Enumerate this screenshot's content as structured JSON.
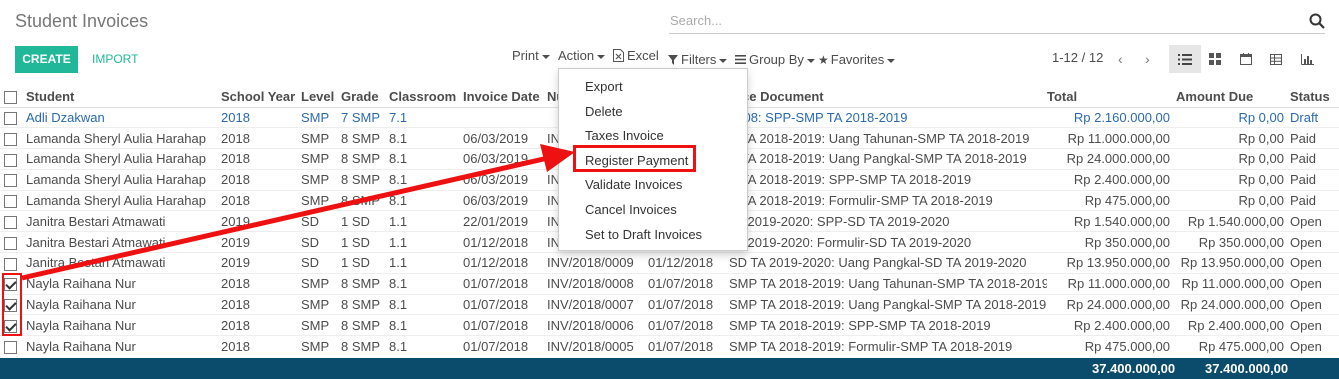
{
  "header": {
    "title": "Student Invoices"
  },
  "search": {
    "placeholder": "Search..."
  },
  "buttons": {
    "create": "CREATE",
    "import": "IMPORT"
  },
  "toolbar": {
    "print": "Print",
    "action": "Action",
    "excel": "Excel",
    "filters": "Filters",
    "group_by": "Group By",
    "favorites": "Favorites"
  },
  "pager": {
    "range": "1-12 / 12"
  },
  "columns": [
    "Student",
    "School Year",
    "Level",
    "Grade",
    "Classroom",
    "Invoice Date",
    "Nu",
    "",
    "urce Document",
    "Total",
    "Amount Due",
    "Status"
  ],
  "rows": [
    {
      "student": "Adli Dzakwan",
      "year": "2018",
      "level": "SMP",
      "grade": "7 SMP",
      "class": "7.1",
      "date": "",
      "number": "",
      "due_date": "",
      "source": "2108: SPP-SMP TA 2018-2019",
      "total": "Rp 2.160.000,00",
      "amount_due": "Rp 0,00",
      "status": "Draft",
      "checked": false
    },
    {
      "student": "Lamanda Sheryl Aulia Harahap",
      "year": "2018",
      "level": "SMP",
      "grade": "8 SMP",
      "class": "8.1",
      "date": "06/03/2019",
      "number": "IN",
      "due_date": "",
      "source": "P TA 2018-2019: Uang Tahunan-SMP TA 2018-2019",
      "total": "Rp 11.000.000,00",
      "amount_due": "Rp 0,00",
      "status": "Paid",
      "checked": false
    },
    {
      "student": "Lamanda Sheryl Aulia Harahap",
      "year": "2018",
      "level": "SMP",
      "grade": "8 SMP",
      "class": "8.1",
      "date": "06/03/2019",
      "number": "IN",
      "due_date": "",
      "source": "P TA 2018-2019: Uang Pangkal-SMP TA 2018-2019",
      "total": "Rp 24.000.000,00",
      "amount_due": "Rp 0,00",
      "status": "Paid",
      "checked": false
    },
    {
      "student": "Lamanda Sheryl Aulia Harahap",
      "year": "2018",
      "level": "SMP",
      "grade": "8 SMP",
      "class": "8.1",
      "date": "06/03/2019",
      "number": "IN",
      "due_date": "",
      "source": "P TA 2018-2019: SPP-SMP TA 2018-2019",
      "total": "Rp 2.400.000,00",
      "amount_due": "Rp 0,00",
      "status": "Paid",
      "checked": false
    },
    {
      "student": "Lamanda Sheryl Aulia Harahap",
      "year": "2018",
      "level": "SMP",
      "grade": "8 SMP",
      "class": "8.1",
      "date": "06/03/2019",
      "number": "IN",
      "due_date": "",
      "source": "P TA 2018-2019: Formulir-SMP TA 2018-2019",
      "total": "Rp 475.000,00",
      "amount_due": "Rp 0,00",
      "status": "Paid",
      "checked": false
    },
    {
      "student": "Janitra Bestari Atmawati",
      "year": "2019",
      "level": "SD",
      "grade": "1 SD",
      "class": "1.1",
      "date": "22/01/2019",
      "number": "IN",
      "due_date": "",
      "source": "TA 2019-2020: SPP-SD TA 2019-2020",
      "total": "Rp 1.540.000,00",
      "amount_due": "Rp 1.540.000,00",
      "status": "Open",
      "checked": false
    },
    {
      "student": "Janitra Bestari Atmawati",
      "year": "2019",
      "level": "SD",
      "grade": "1 SD",
      "class": "1.1",
      "date": "01/12/2018",
      "number": "IN",
      "due_date": "",
      "source": "TA 2019-2020: Formulir-SD TA 2019-2020",
      "total": "Rp 350.000,00",
      "amount_due": "Rp 350.000,00",
      "status": "Open",
      "checked": false
    },
    {
      "student": "Janitra Bestari Atmawati",
      "year": "2019",
      "level": "SD",
      "grade": "1 SD",
      "class": "1.1",
      "date": "01/12/2018",
      "number": "INV/2018/0009",
      "due_date": "01/12/2018",
      "source": "SD TA 2019-2020: Uang Pangkal-SD TA 2019-2020",
      "total": "Rp 13.950.000,00",
      "amount_due": "Rp 13.950.000,00",
      "status": "Open",
      "checked": false
    },
    {
      "student": "Nayla Raihana Nur",
      "year": "2018",
      "level": "SMP",
      "grade": "8 SMP",
      "class": "8.1",
      "date": "01/07/2018",
      "number": "INV/2018/0008",
      "due_date": "01/07/2018",
      "source": "SMP TA 2018-2019: Uang Tahunan-SMP TA 2018-2019",
      "total": "Rp 11.000.000,00",
      "amount_due": "Rp 11.000.000,00",
      "status": "Open",
      "checked": true
    },
    {
      "student": "Nayla Raihana Nur",
      "year": "2018",
      "level": "SMP",
      "grade": "8 SMP",
      "class": "8.1",
      "date": "01/07/2018",
      "number": "INV/2018/0007",
      "due_date": "01/07/2018",
      "source": "SMP TA 2018-2019: Uang Pangkal-SMP TA 2018-2019",
      "total": "Rp 24.000.000,00",
      "amount_due": "Rp 24.000.000,00",
      "status": "Open",
      "checked": true
    },
    {
      "student": "Nayla Raihana Nur",
      "year": "2018",
      "level": "SMP",
      "grade": "8 SMP",
      "class": "8.1",
      "date": "01/07/2018",
      "number": "INV/2018/0006",
      "due_date": "01/07/2018",
      "source": "SMP TA 2018-2019: SPP-SMP TA 2018-2019",
      "total": "Rp 2.400.000,00",
      "amount_due": "Rp 2.400.000,00",
      "status": "Open",
      "checked": true
    },
    {
      "student": "Nayla Raihana Nur",
      "year": "2018",
      "level": "SMP",
      "grade": "8 SMP",
      "class": "8.1",
      "date": "01/07/2018",
      "number": "INV/2018/0005",
      "due_date": "01/07/2018",
      "source": "SMP TA 2018-2019: Formulir-SMP TA 2018-2019",
      "total": "Rp 475.000,00",
      "amount_due": "Rp 475.000,00",
      "status": "Open",
      "checked": false
    }
  ],
  "footer": {
    "total_sum": "37.400.000,00",
    "amount_due_sum": "37.400.000,00"
  },
  "action_menu": [
    "Export",
    "Delete",
    "Taxes Invoice",
    "Register Payment",
    "Validate Invoices",
    "Cancel Invoices",
    "Set to Draft Invoices"
  ],
  "colors": {
    "primary": "#21b799",
    "footer": "#0b4b6b",
    "annotation": "#ee1111",
    "draft_text": "#2a6ab0"
  }
}
